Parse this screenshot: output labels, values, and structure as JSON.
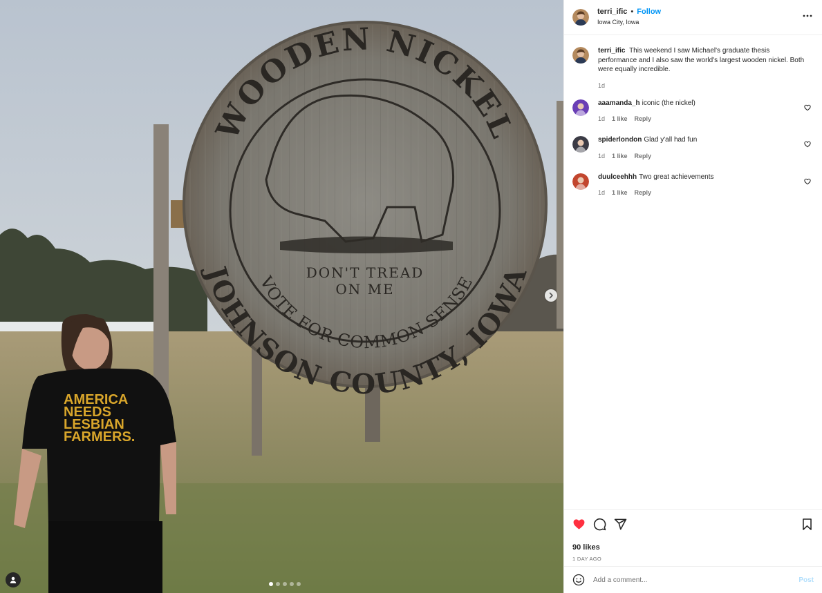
{
  "post": {
    "author": {
      "username": "terri_ific",
      "follow_label": "Follow",
      "separator": "•",
      "location": "Iowa City, Iowa"
    },
    "more_icon": "more-horizontal-icon",
    "media": {
      "sign_lines": [
        "WOODEN NICKEL",
        "JOHNSON COUNTY, IOWA",
        "DON'T TREAD",
        "ON ME",
        "VOTE FOR COMMON SENSE"
      ],
      "shirt_lines": [
        "AMERICA",
        "NEEDS",
        "LESBIAN",
        "FARMERS."
      ],
      "carousel": {
        "count": 5,
        "active": 1
      }
    },
    "caption": {
      "username": "terri_ific",
      "text": "This weekend I saw Michael's graduate thesis performance and I also saw the world's largest wooden nickel. Both were equally incredible.",
      "time": "1d"
    },
    "comments": [
      {
        "username": "aaamanda_h",
        "text": "iconic (the nickel)",
        "time": "1d",
        "likes": "1 like",
        "reply": "Reply",
        "avatar_color": "#6a3fb5"
      },
      {
        "username": "spiderlondon",
        "text": "Glad y'all had fun",
        "time": "1d",
        "likes": "1 like",
        "reply": "Reply",
        "avatar_color": "#3b3b45"
      },
      {
        "username": "duulceehhh",
        "text": "Two great achievements",
        "time": "1d",
        "likes": "1 like",
        "reply": "Reply",
        "avatar_color": "#c2462e"
      }
    ],
    "likes_label": "90 likes",
    "time_ago": "1 DAY AGO",
    "composer": {
      "placeholder": "Add a comment...",
      "post_label": "Post"
    },
    "colors": {
      "accent": "#0095f6",
      "liked_heart": "#ff3040",
      "post_disabled": "#b2dffc"
    }
  }
}
